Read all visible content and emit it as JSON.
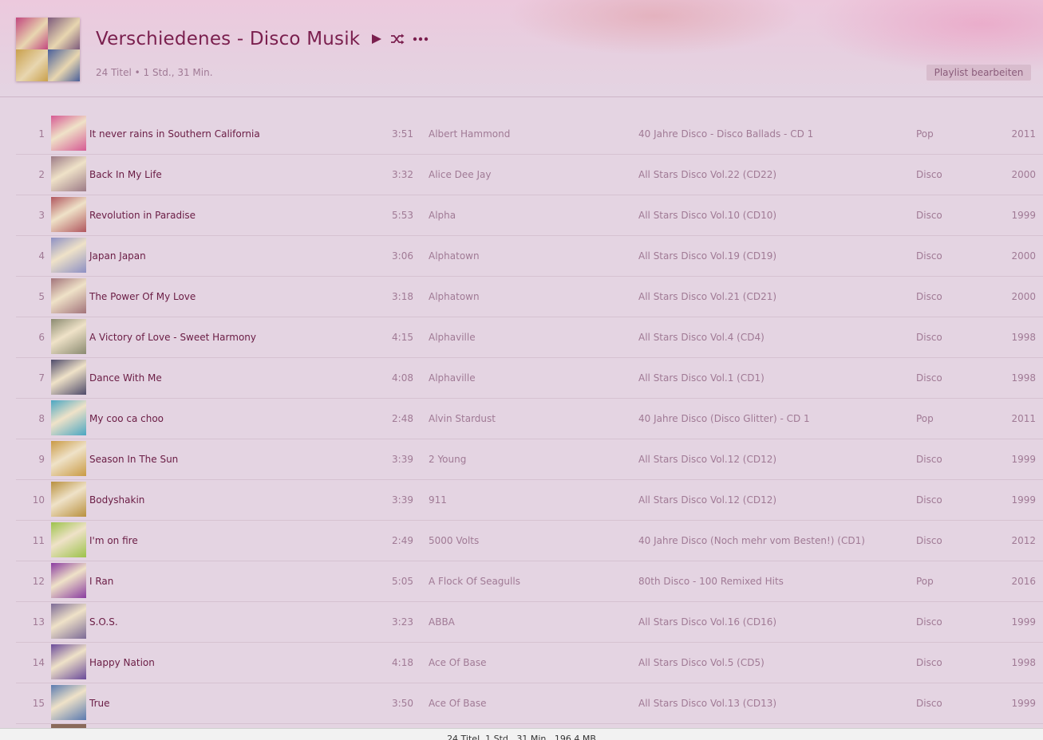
{
  "header": {
    "title": "Verschiedenes - Disco Musik",
    "subtitle": "24 Titel • 1 Std., 31 Min.",
    "edit_label": "Playlist bearbeiten",
    "icons": [
      "play-icon",
      "shuffle-icon",
      "more-icon"
    ],
    "cover_colors": [
      "#c2467e",
      "#7d5a7c",
      "#c9a04c",
      "#4a5f9a"
    ]
  },
  "tracks": [
    {
      "num": "1",
      "title": "It never rains in Southern California",
      "duration": "3:51",
      "artist": "Albert Hammond",
      "album": "40 Jahre Disco - Disco Ballads - CD 1",
      "genre": "Pop",
      "year": "2011",
      "color": "#d65a93"
    },
    {
      "num": "2",
      "title": "Back In My Life",
      "duration": "3:32",
      "artist": "Alice Dee Jay",
      "album": "All Stars Disco Vol.22 (CD22)",
      "genre": "Disco",
      "year": "2000",
      "color": "#9c7a86"
    },
    {
      "num": "3",
      "title": "Revolution in Paradise",
      "duration": "5:53",
      "artist": "Alpha",
      "album": "All Stars Disco Vol.10 (CD10)",
      "genre": "Disco",
      "year": "1999",
      "color": "#b0565e"
    },
    {
      "num": "4",
      "title": "Japan Japan",
      "duration": "3:06",
      "artist": "Alphatown",
      "album": "All Stars Disco Vol.19 (CD19)",
      "genre": "Disco",
      "year": "2000",
      "color": "#8c8fc4"
    },
    {
      "num": "5",
      "title": "The Power Of My Love",
      "duration": "3:18",
      "artist": "Alphatown",
      "album": "All Stars Disco Vol.21 (CD21)",
      "genre": "Disco",
      "year": "2000",
      "color": "#a2737a"
    },
    {
      "num": "6",
      "title": "A Victory of Love - Sweet Harmony",
      "duration": "4:15",
      "artist": "Alphaville",
      "album": "All Stars Disco Vol.4 (CD4)",
      "genre": "Disco",
      "year": "1998",
      "color": "#8a8a70"
    },
    {
      "num": "7",
      "title": "Dance With Me",
      "duration": "4:08",
      "artist": "Alphaville",
      "album": "All Stars Disco Vol.1 (CD1)",
      "genre": "Disco",
      "year": "1998",
      "color": "#4e4a6a"
    },
    {
      "num": "8",
      "title": "My coo ca choo",
      "duration": "2:48",
      "artist": "Alvin Stardust",
      "album": "40 Jahre Disco (Disco Glitter) - CD 1",
      "genre": "Pop",
      "year": "2011",
      "color": "#4aa6c2"
    },
    {
      "num": "9",
      "title": "Season In The Sun",
      "duration": "3:39",
      "artist": "2 Young",
      "album": "All Stars Disco Vol.12 (CD12)",
      "genre": "Disco",
      "year": "1999",
      "color": "#c99a44"
    },
    {
      "num": "10",
      "title": "Bodyshakin",
      "duration": "3:39",
      "artist": "911",
      "album": "All Stars Disco Vol.12 (CD12)",
      "genre": "Disco",
      "year": "1999",
      "color": "#b8903e"
    },
    {
      "num": "11",
      "title": "I'm on fire",
      "duration": "2:49",
      "artist": "5000 Volts",
      "album": "40 Jahre Disco (Noch mehr vom Besten!) (CD1)",
      "genre": "Disco",
      "year": "2012",
      "color": "#9cc24a"
    },
    {
      "num": "12",
      "title": "I Ran",
      "duration": "5:05",
      "artist": "A Flock Of Seagulls",
      "album": "80th Disco - 100 Remixed Hits",
      "genre": "Pop",
      "year": "2016",
      "color": "#8a3ca0"
    },
    {
      "num": "13",
      "title": "S.O.S.",
      "duration": "3:23",
      "artist": "ABBA",
      "album": "All Stars Disco Vol.16 (CD16)",
      "genre": "Disco",
      "year": "1999",
      "color": "#7c6a96"
    },
    {
      "num": "14",
      "title": "Happy Nation",
      "duration": "4:18",
      "artist": "Ace Of Base",
      "album": "All Stars Disco Vol.5 (CD5)",
      "genre": "Disco",
      "year": "1998",
      "color": "#6a4a9a"
    },
    {
      "num": "15",
      "title": "True",
      "duration": "3:50",
      "artist": "Ace Of Base",
      "album": "All Stars Disco Vol.13 (CD13)",
      "genre": "Disco",
      "year": "1999",
      "color": "#5a7ab0"
    }
  ],
  "partial_track_color": "#8a6a5a",
  "status_bar": {
    "text": "24 Titel, 1 Std., 31 Min., 196,4 MB"
  }
}
